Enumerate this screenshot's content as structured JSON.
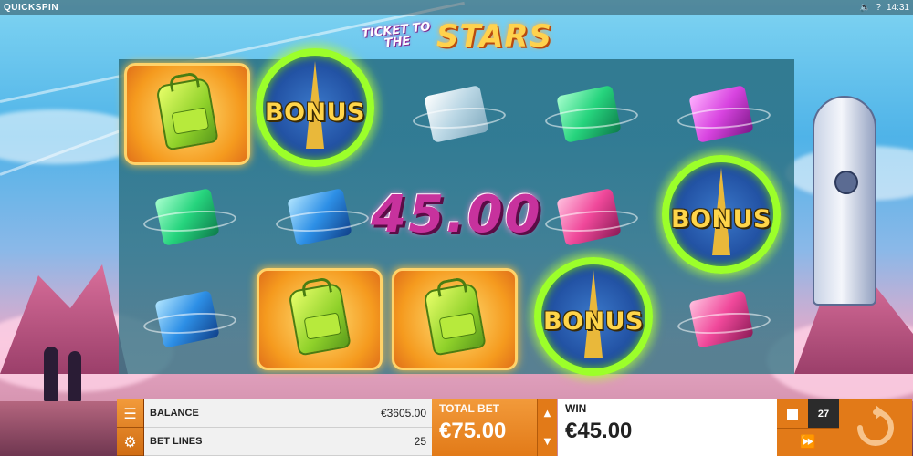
{
  "topbar": {
    "brand": "QUICKSPIN",
    "sound_icon": "speaker-icon",
    "question_icon": "help-icon",
    "time": "14:31"
  },
  "logo": {
    "small": "TICKET TO THE",
    "big": "STARS"
  },
  "reels": {
    "bonus_label": "BONUS",
    "win_amount": "45.00"
  },
  "controls": {
    "balance_label": "BALANCE",
    "balance_value": "€3605.00",
    "betlines_label": "BET LINES",
    "betlines_value": "25",
    "totalbet_label": "TOTAL BET",
    "totalbet_value": "€75.00",
    "win_label": "WIN",
    "win_value": "€45.00",
    "autoplay_count": "27"
  },
  "colors": {
    "accent": "#e27a18",
    "bonus_ring": "#9cff2a",
    "win_text": "#c7329d"
  }
}
